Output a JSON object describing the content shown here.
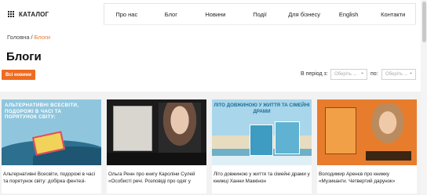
{
  "header": {
    "catalog_label": "КАТАЛОГ",
    "nav": [
      "Про нас",
      "Блог",
      "Новини",
      "Події",
      "Для бізнесу",
      "English",
      "Контакти"
    ]
  },
  "breadcrumb": {
    "home": "Головна",
    "separator": "/",
    "current": "Блоги"
  },
  "page": {
    "title": "Блоги",
    "all_news_button": "Всі новини"
  },
  "filter": {
    "period_label": "В період з:",
    "from_placeholder": "Оберіть ...",
    "to_label": "по:",
    "to_placeholder": "Оберіть ..."
  },
  "cards": [
    {
      "image_title": "АЛЬТЕРНАТИВНІ ВСЕСВІТИ, ПОДОРОЖІ В ЧАСІ ТА ПОРЯТУНОК СВІТУ:",
      "caption": "Альтернативні Всесвіти, подорожі в часі та порятунок світу: добірка фентезі-"
    },
    {
      "caption": "Ольга Ренн про книгу Кароліни Сулей «Особисті речі. Розповіді про одяг у"
    },
    {
      "image_title": "ЛІТО ДОВЖИНОЮ У ЖИТТЯ ТА СІМЕЙНІ ДРАМИ",
      "caption": "Літо довжиною у життя та сімейні драми у книжці Ханни Маккінон"
    },
    {
      "caption": "Володимир Аренєв про книжку «Музиканти. Четвертий дарунок»"
    }
  ],
  "colors": {
    "accent": "#ee6b21",
    "breadcrumb_current": "#e8752a"
  }
}
